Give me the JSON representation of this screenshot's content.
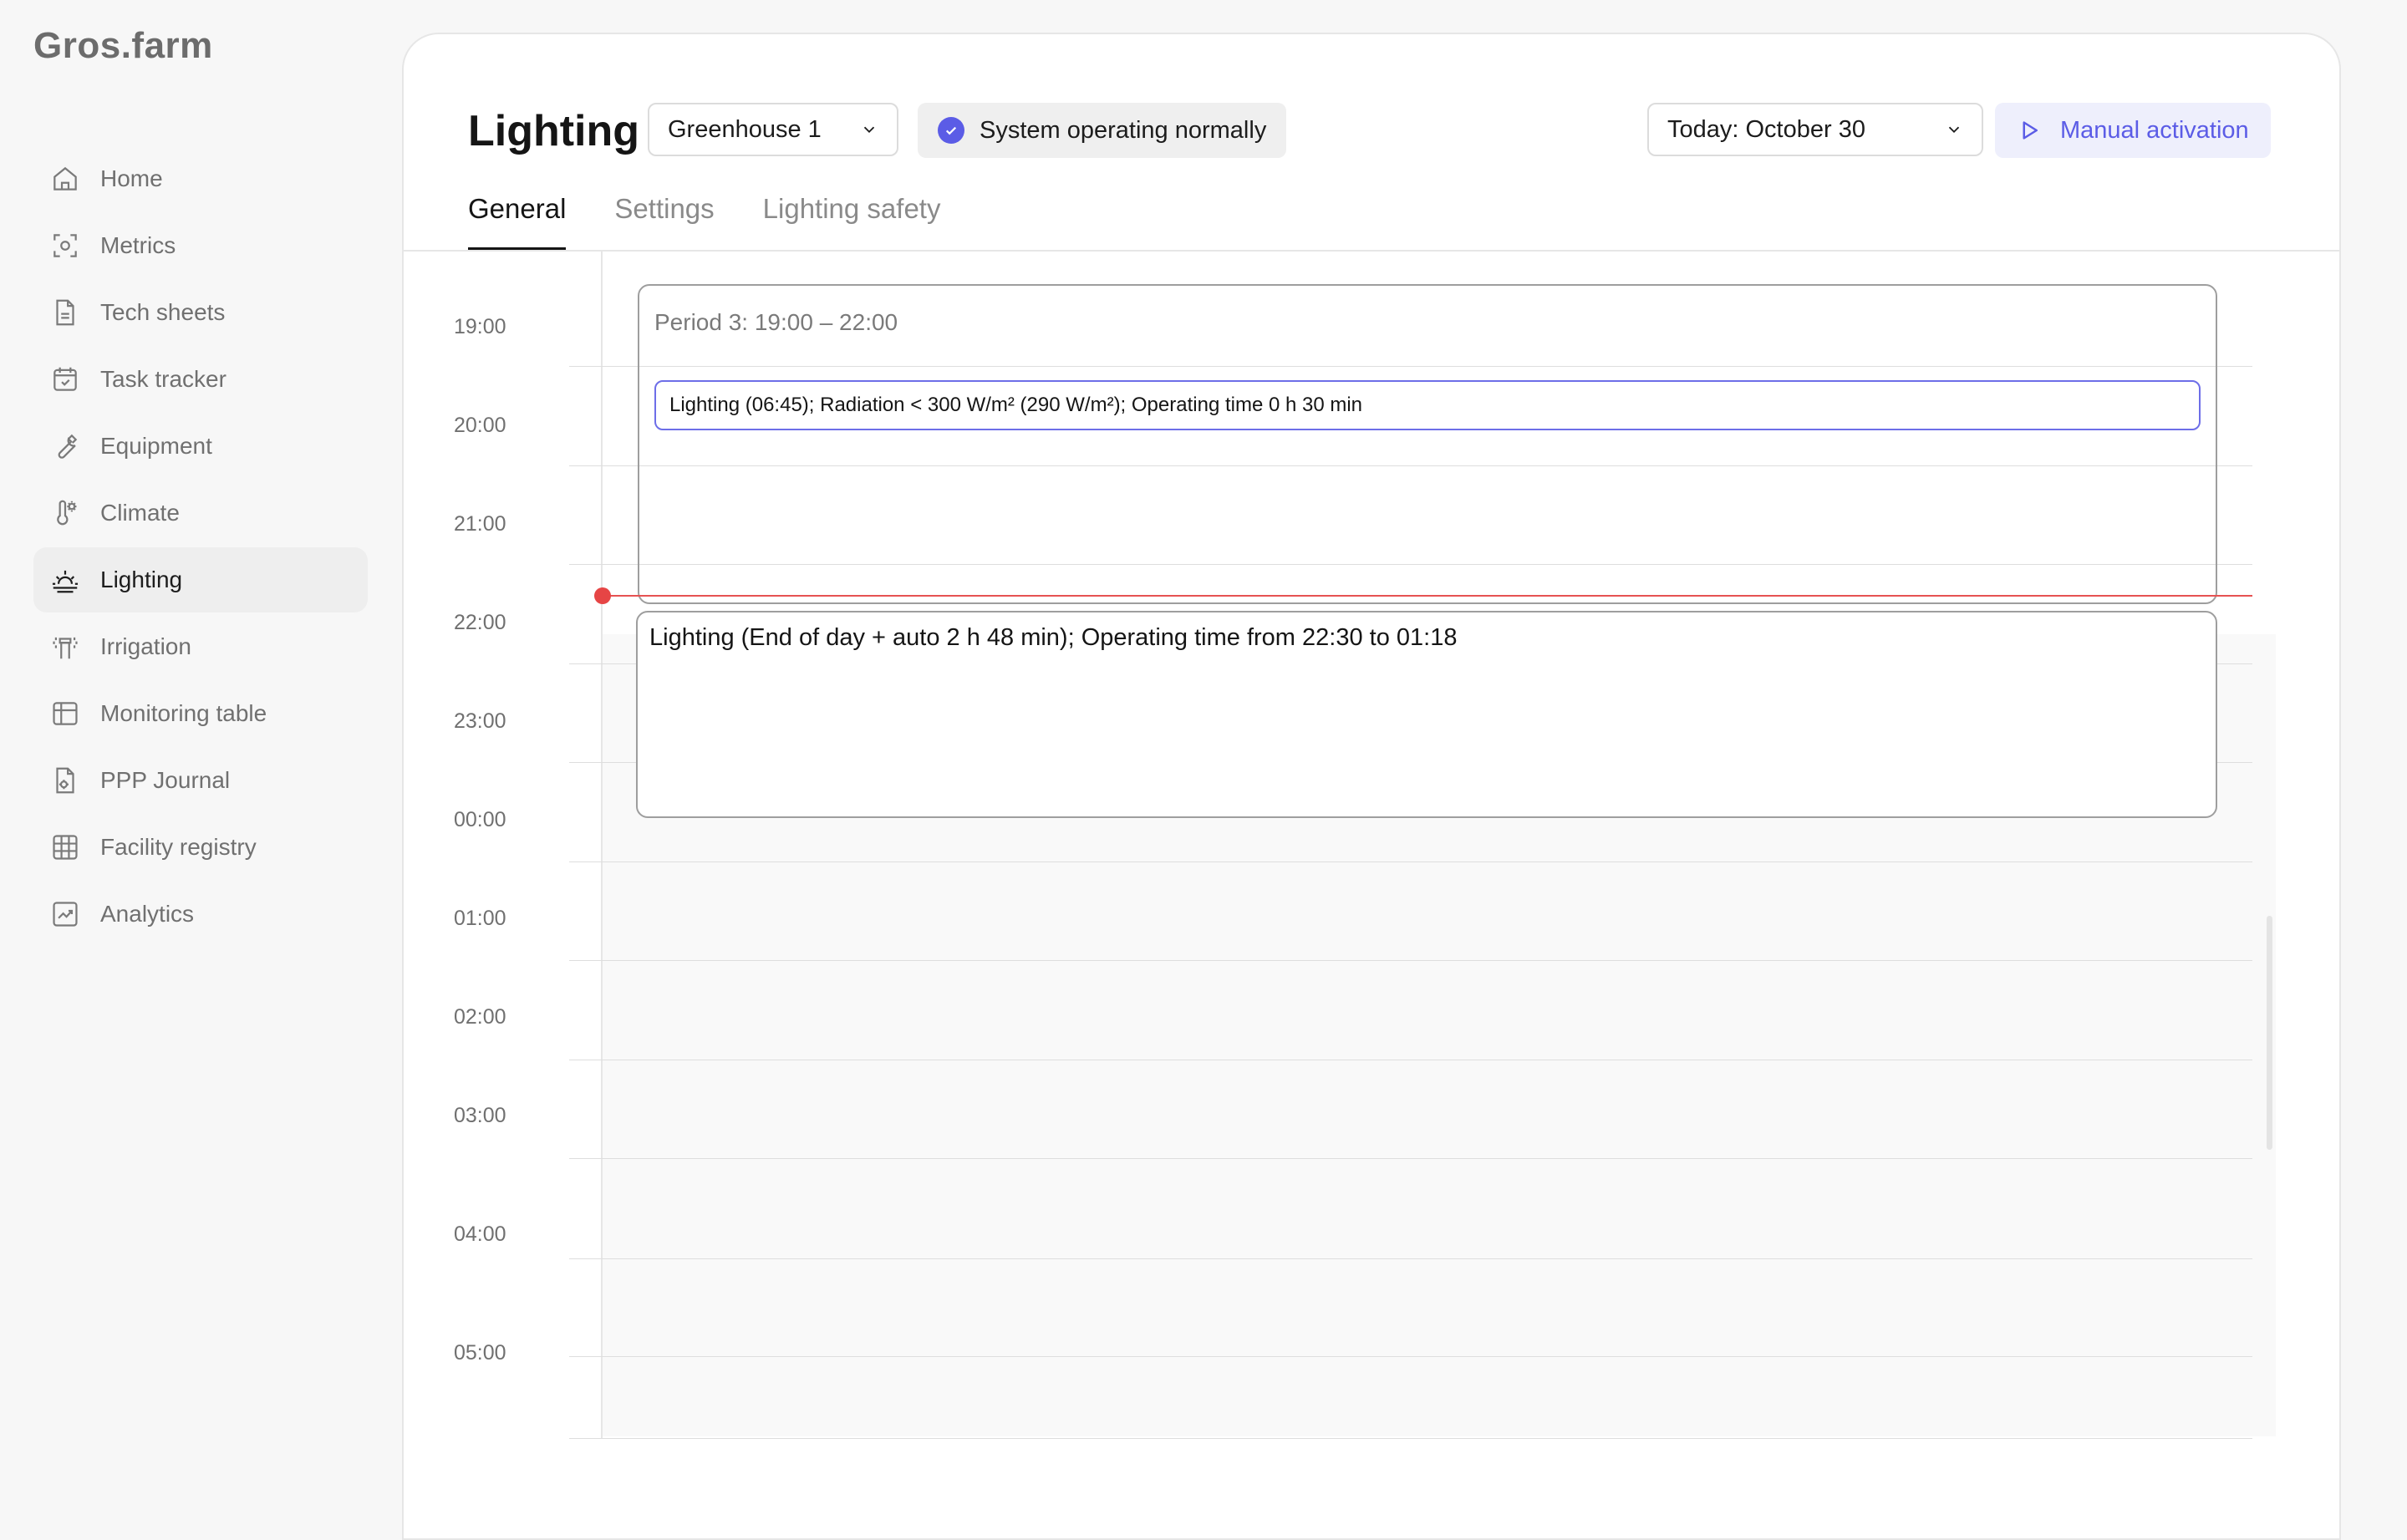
{
  "app": {
    "logo": "Gros.farm"
  },
  "sidebar": {
    "items": [
      {
        "label": "Home",
        "icon": "home-icon"
      },
      {
        "label": "Metrics",
        "icon": "metrics-icon"
      },
      {
        "label": "Tech sheets",
        "icon": "document-icon"
      },
      {
        "label": "Task tracker",
        "icon": "calendar-check-icon"
      },
      {
        "label": "Equipment",
        "icon": "wrench-icon"
      },
      {
        "label": "Climate",
        "icon": "thermometer-sun-icon"
      },
      {
        "label": "Lighting",
        "icon": "sunrise-icon",
        "active": true
      },
      {
        "label": "Irrigation",
        "icon": "sprinkler-icon"
      },
      {
        "label": "Monitoring table",
        "icon": "table-icon"
      },
      {
        "label": "PPP Journal",
        "icon": "journal-icon"
      },
      {
        "label": "Facility registry",
        "icon": "grid-icon"
      },
      {
        "label": "Analytics",
        "icon": "chart-icon"
      }
    ]
  },
  "header": {
    "title": "Lighting",
    "greenhouse_select": "Greenhouse 1",
    "status": "System operating normally",
    "date_select": "Today: October 30",
    "manual_button": "Manual activation"
  },
  "tabs": [
    {
      "label": "General",
      "active": true
    },
    {
      "label": "Settings",
      "active": false
    },
    {
      "label": "Lighting safety",
      "active": false
    }
  ],
  "timeline": {
    "hours": [
      "19:00",
      "20:00",
      "21:00",
      "22:00",
      "23:00",
      "00:00",
      "01:00",
      "02:00",
      "03:00",
      "04:00",
      "05:00"
    ],
    "period": {
      "label": "Period 3: 19:00 – 22:00",
      "event": "Lighting (06:45); Radiation < 300 W/m² (290 W/m²); Operating time 0 h 30 min"
    },
    "end_of_day_event": "Lighting (End of day + auto 2 h 48 min); Operating time from 22:30 to 01:18"
  },
  "colors": {
    "accent": "#5b5ce6",
    "now_indicator": "#e64545",
    "active_nav_bg": "#eeeeee"
  }
}
